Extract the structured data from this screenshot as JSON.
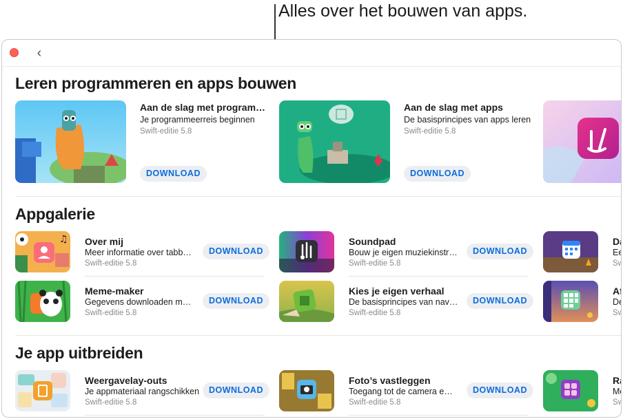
{
  "callout": "Alles over het bouwen van apps.",
  "window": {
    "back": "‹"
  },
  "sections": {
    "learn": {
      "title": "Leren programmeren en apps bouwen",
      "cards": [
        {
          "title": "Aan de slag met program…",
          "subtitle": "Je programmeerreis beginnen",
          "meta": "Swift-editie 5.8",
          "button": "DOWNLOAD"
        },
        {
          "title": "Aan de slag met apps",
          "subtitle": "De basisprincipes van apps leren",
          "meta": "Swift-editie 5.8",
          "button": "DOWNLOAD"
        }
      ]
    },
    "gallery": {
      "title": "Appgalerie",
      "items": [
        {
          "title": "Over mij",
          "subtitle": "Meer informatie over tabb…",
          "meta": "Swift-editie 5.8",
          "button": "DOWNLOAD"
        },
        {
          "title": "Soundpad",
          "subtitle": "Bouw je eigen muziekinstr…",
          "meta": "Swift-editie 5.8",
          "button": "DOWNLOAD"
        },
        {
          "title": "Da",
          "subtitle": "Een",
          "meta": "Swift"
        },
        {
          "title": "Meme-maker",
          "subtitle": "Gegevens downloaden me…",
          "meta": "Swift-editie 5.8",
          "button": "DOWNLOAD"
        },
        {
          "title": "Kies je eigen verhaal",
          "subtitle": "De basisprincipes van nav…",
          "meta": "Swift-editie 5.8",
          "button": "DOWNLOAD"
        },
        {
          "title": "Af",
          "subtitle": "De",
          "meta": "Swift"
        }
      ]
    },
    "extend": {
      "title": "Je app uitbreiden",
      "items": [
        {
          "title": "Weergavelay-outs",
          "subtitle": "Je appmateriaal rangschikken",
          "meta": "Swift-editie 5.8",
          "button": "DOWNLOAD"
        },
        {
          "title": "Foto’s vastleggen",
          "subtitle": "Toegang tot de camera e…",
          "meta": "Swift-editie 5.8",
          "button": "DOWNLOAD"
        },
        {
          "title": "Ra",
          "subtitle": "Me",
          "meta": "Swift"
        }
      ]
    }
  },
  "colors": {
    "accent": "#0a6cdc",
    "button_bg": "#eceef2",
    "close": "#ff5f57"
  },
  "icons": [
    "close-dot",
    "back-chevron",
    "metronome-icon",
    "calendar-icon",
    "grid-icon",
    "camera-icon",
    "pencil-book-icon",
    "peace-sign-icon"
  ]
}
